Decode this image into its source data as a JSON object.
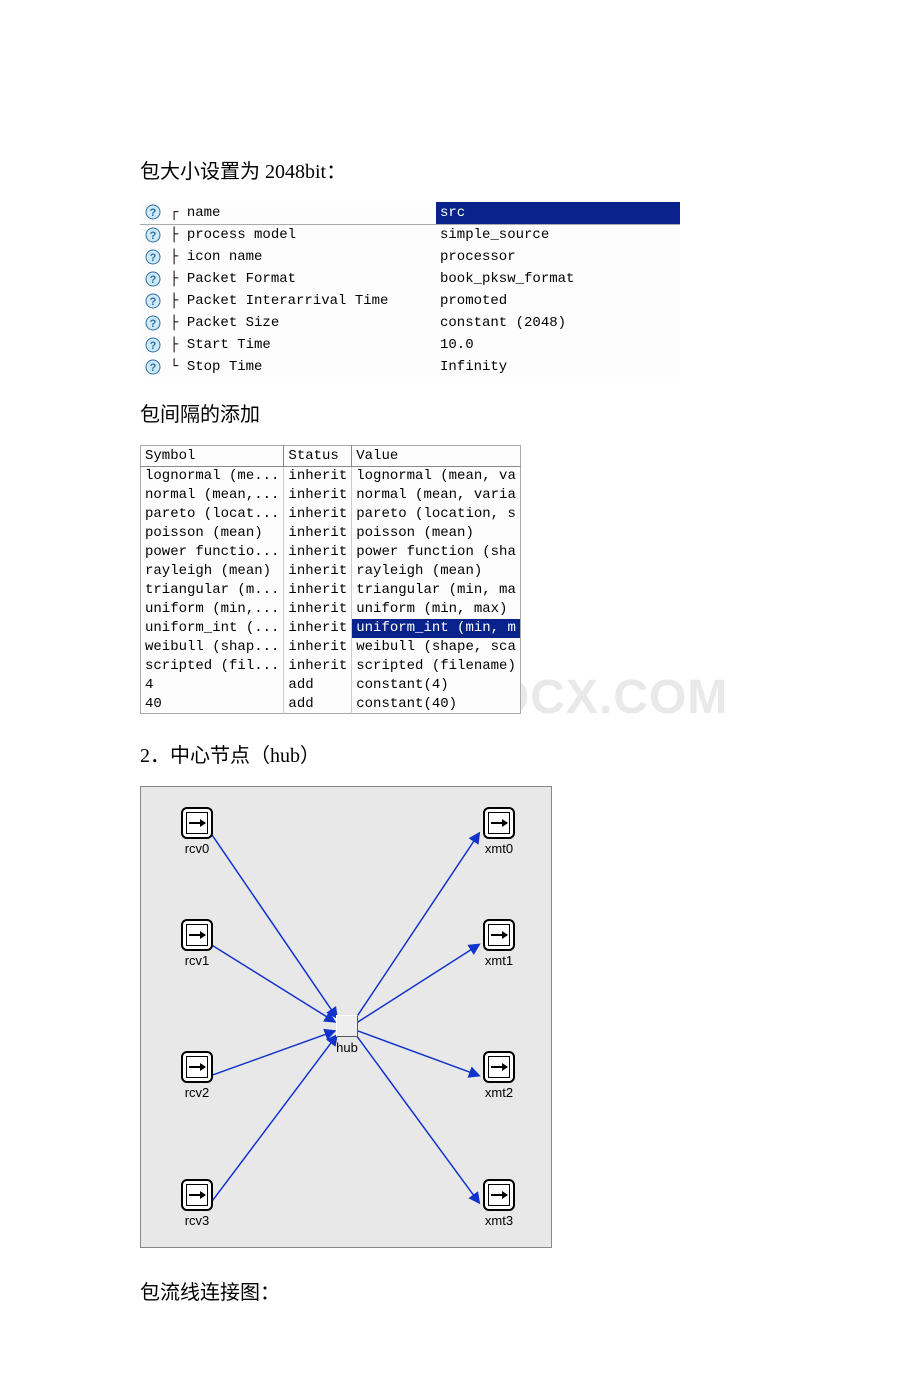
{
  "headings": {
    "packet_size": "包大小设置为 2048bit：",
    "packet_interval": "包间隔的添加",
    "hub_section": "2．中心节点（hub）",
    "flow_diagram": "包流线连接图："
  },
  "attr_table": {
    "header_label": "src",
    "rows": [
      {
        "tree": "┌",
        "attr": "name",
        "value": "src"
      },
      {
        "tree": "├",
        "attr": "process model",
        "value": "simple_source"
      },
      {
        "tree": "├",
        "attr": "icon name",
        "value": "processor"
      },
      {
        "tree": "├",
        "attr": "Packet Format",
        "value": "book_pksw_format"
      },
      {
        "tree": "├",
        "attr": "Packet Interarrival Time",
        "value": "promoted"
      },
      {
        "tree": "├",
        "attr": "Packet Size",
        "value": "constant (2048)"
      },
      {
        "tree": "├",
        "attr": "Start Time",
        "value": "10.0"
      },
      {
        "tree": "└",
        "attr": "Stop Time",
        "value": "Infinity"
      }
    ]
  },
  "sym_table": {
    "headers": {
      "symbol": "Symbol",
      "status": "Status",
      "value": "Value"
    },
    "rows": [
      {
        "symbol": "lognormal (me...",
        "status": "inherit",
        "value": "lognormal (mean, va",
        "hl": false
      },
      {
        "symbol": "normal (mean,...",
        "status": "inherit",
        "value": "normal (mean, varia",
        "hl": false
      },
      {
        "symbol": "pareto (locat...",
        "status": "inherit",
        "value": "pareto (location, s",
        "hl": false
      },
      {
        "symbol": "poisson (mean)",
        "status": "inherit",
        "value": "poisson (mean)",
        "hl": false
      },
      {
        "symbol": "power functio...",
        "status": "inherit",
        "value": "power function (sha",
        "hl": false
      },
      {
        "symbol": "rayleigh (mean)",
        "status": "inherit",
        "value": "rayleigh (mean)",
        "hl": false
      },
      {
        "symbol": "triangular (m...",
        "status": "inherit",
        "value": "triangular (min, ma",
        "hl": false
      },
      {
        "symbol": "uniform (min,...",
        "status": "inherit",
        "value": "uniform (min, max)",
        "hl": false
      },
      {
        "symbol": "uniform_int (...",
        "status": "inherit",
        "value": "uniform_int (min, m",
        "hl": true
      },
      {
        "symbol": "weibull (shap...",
        "status": "inherit",
        "value": "weibull (shape, sca",
        "hl": false
      },
      {
        "symbol": "scripted (fil...",
        "status": "inherit",
        "value": "scripted (filename)",
        "hl": false
      },
      {
        "symbol": "4",
        "status": "add",
        "value": "constant(4)",
        "hl": false
      },
      {
        "symbol": "40",
        "status": "add",
        "value": "constant(40)",
        "hl": false
      }
    ]
  },
  "watermark": "WWW.BDOCX.COM",
  "hub_diagram": {
    "hub_label": "hub",
    "nodes": {
      "rcv0": "rcv0",
      "rcv1": "rcv1",
      "rcv2": "rcv2",
      "rcv3": "rcv3",
      "xmt0": "xmt0",
      "xmt1": "xmt1",
      "xmt2": "xmt2",
      "xmt3": "xmt3"
    }
  }
}
